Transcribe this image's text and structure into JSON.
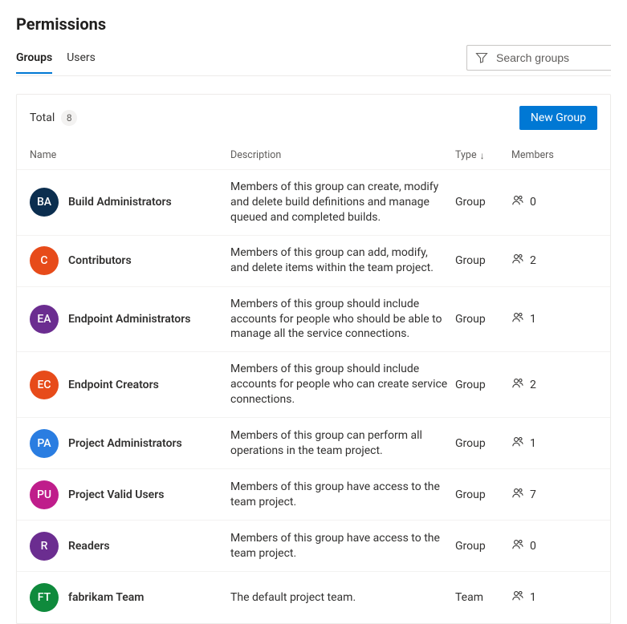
{
  "title": "Permissions",
  "tabs": {
    "groups": "Groups",
    "users": "Users"
  },
  "search": {
    "placeholder": "Search groups"
  },
  "total": {
    "label": "Total",
    "count": "8"
  },
  "newGroupLabel": "New Group",
  "columns": {
    "name": "Name",
    "description": "Description",
    "type": "Type",
    "members": "Members"
  },
  "groups": [
    {
      "initials": "BA",
      "color": "#0b2e4f",
      "name": "Build Administrators",
      "desc": "Members of this group can create, modify and delete build definitions and manage queued and completed builds.",
      "type": "Group",
      "members": "0"
    },
    {
      "initials": "C",
      "color": "#e74b1a",
      "name": "Contributors",
      "desc": "Members of this group can add, modify, and delete items within the team project.",
      "type": "Group",
      "members": "2"
    },
    {
      "initials": "EA",
      "color": "#6b2d90",
      "name": "Endpoint Administrators",
      "desc": "Members of this group should include accounts for people who should be able to manage all the service connections.",
      "type": "Group",
      "members": "1"
    },
    {
      "initials": "EC",
      "color": "#e74b1a",
      "name": "Endpoint Creators",
      "desc": "Members of this group should include accounts for people who can create service connections.",
      "type": "Group",
      "members": "2"
    },
    {
      "initials": "PA",
      "color": "#2a7de1",
      "name": "Project Administrators",
      "desc": "Members of this group can perform all operations in the team project.",
      "type": "Group",
      "members": "1"
    },
    {
      "initials": "PU",
      "color": "#bf1d8b",
      "name": "Project Valid Users",
      "desc": "Members of this group have access to the team project.",
      "type": "Group",
      "members": "7"
    },
    {
      "initials": "R",
      "color": "#6b2d90",
      "name": "Readers",
      "desc": "Members of this group have access to the team project.",
      "type": "Group",
      "members": "0"
    },
    {
      "initials": "FT",
      "color": "#0f8a3c",
      "name": "fabrikam Team",
      "desc": "The default project team.",
      "type": "Team",
      "members": "1"
    }
  ]
}
